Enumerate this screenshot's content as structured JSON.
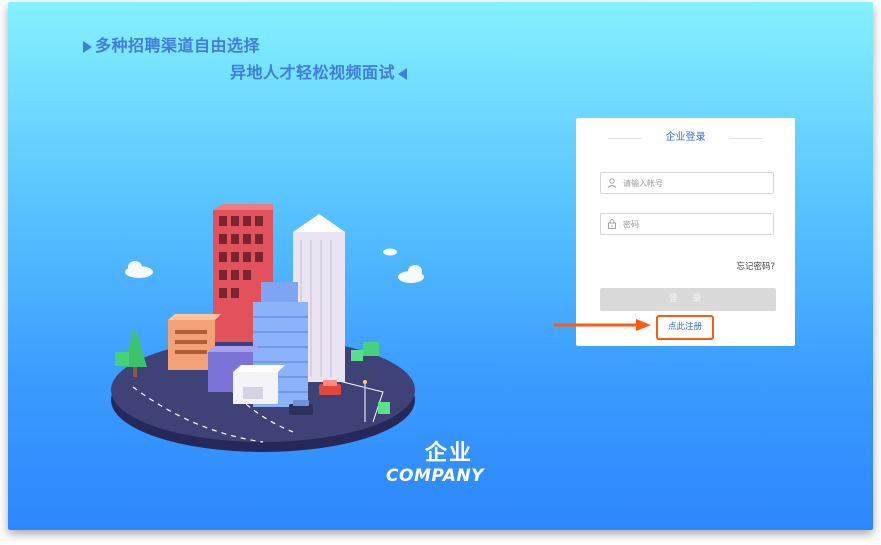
{
  "hero": {
    "slogan_line1": "多种招聘渠道自由选择",
    "slogan_line2": "异地人才轻松视频面试"
  },
  "brand": {
    "cn": "企业",
    "en": "COMPANY"
  },
  "login_card": {
    "title": "企业登录",
    "account_placeholder": "请输入帐号",
    "password_placeholder": "密码",
    "forgot_label": "忘记密码?",
    "login_label": "登 录",
    "register_label": "点此注册"
  },
  "icons": {
    "user": "user-icon",
    "lock": "lock-icon",
    "annotation": "arrow-right-icon"
  },
  "colors": {
    "accent": "#2f6fd6",
    "highlight": "#ff5a14",
    "button_disabled": "#dadada"
  }
}
